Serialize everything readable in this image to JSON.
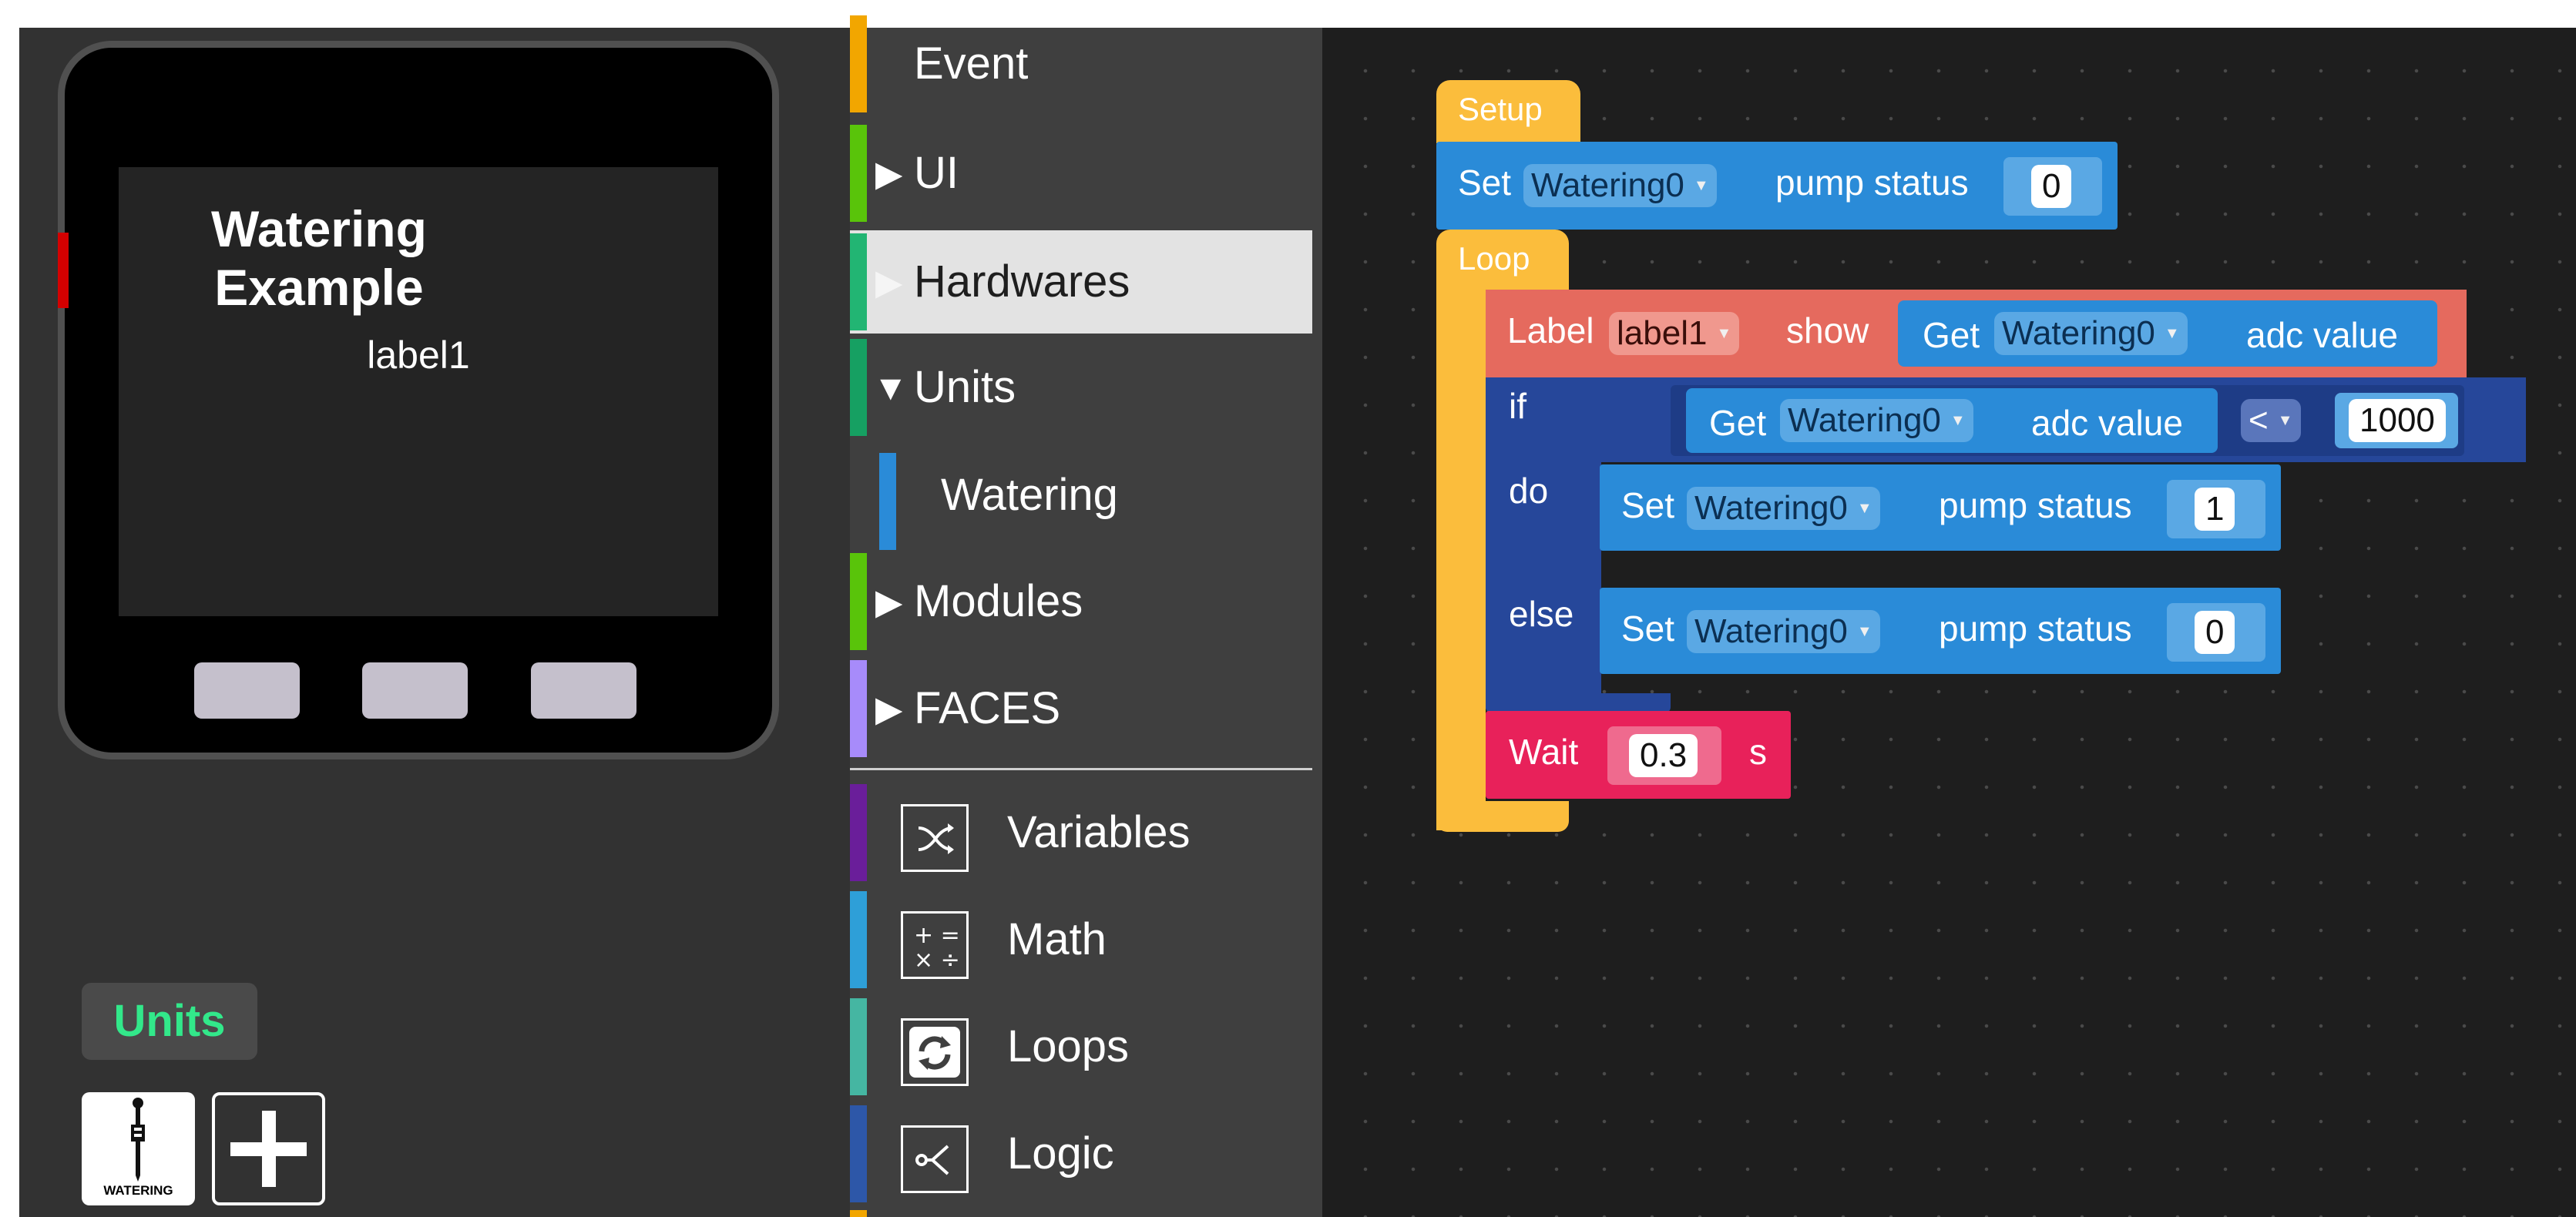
{
  "device": {
    "screen_title": "Watering Example",
    "screen_label": "label1"
  },
  "units_panel": {
    "badge": "Units",
    "tile_caption": "WATERING"
  },
  "toolbox": {
    "categories": [
      {
        "label": "Event",
        "color": "#f2a600"
      },
      {
        "label": "UI",
        "color": "#59c40a"
      },
      {
        "label": "Hardwares",
        "color": "#22b573"
      },
      {
        "label": "Units",
        "color": "#16a062"
      },
      {
        "label": "Watering",
        "color": "#2a8bd8"
      },
      {
        "label": "Modules",
        "color": "#59c40a"
      },
      {
        "label": "FACES",
        "color": "#a78bfa"
      },
      {
        "label": "Variables",
        "color": "#6a1e9a"
      },
      {
        "label": "Math",
        "color": "#2e9fd8"
      },
      {
        "label": "Loops",
        "color": "#45b6a2"
      },
      {
        "label": "Logic",
        "color": "#2d57a8"
      }
    ],
    "selected": "Hardwares"
  },
  "blocks": {
    "setup": {
      "hat": "Setup"
    },
    "set1": {
      "kw": "Set",
      "device": "Watering0",
      "prop": "pump status",
      "value": "0"
    },
    "loop": {
      "hat": "Loop"
    },
    "label_show": {
      "kw": "Label",
      "label": "label1",
      "show": "show",
      "get": "Get",
      "device": "Watering0",
      "prop": "adc value"
    },
    "if_block": {
      "if": "if",
      "do": "do",
      "else": "else",
      "get": "Get",
      "device": "Watering0",
      "prop": "adc value",
      "op": "<",
      "value": "1000"
    },
    "set_do": {
      "kw": "Set",
      "device": "Watering0",
      "prop": "pump status",
      "value": "1"
    },
    "set_else": {
      "kw": "Set",
      "device": "Watering0",
      "prop": "pump status",
      "value": "0"
    },
    "wait": {
      "kw": "Wait",
      "value": "0.3",
      "unit": "s"
    }
  },
  "colors": {
    "event_yellow": "#fbbd3c",
    "hardware_blue": "#2a8bd8",
    "label_red": "#e56a5e",
    "logic_blue": "#26479a",
    "wait_pink": "#e8215a",
    "units_green": "#32e88a"
  }
}
